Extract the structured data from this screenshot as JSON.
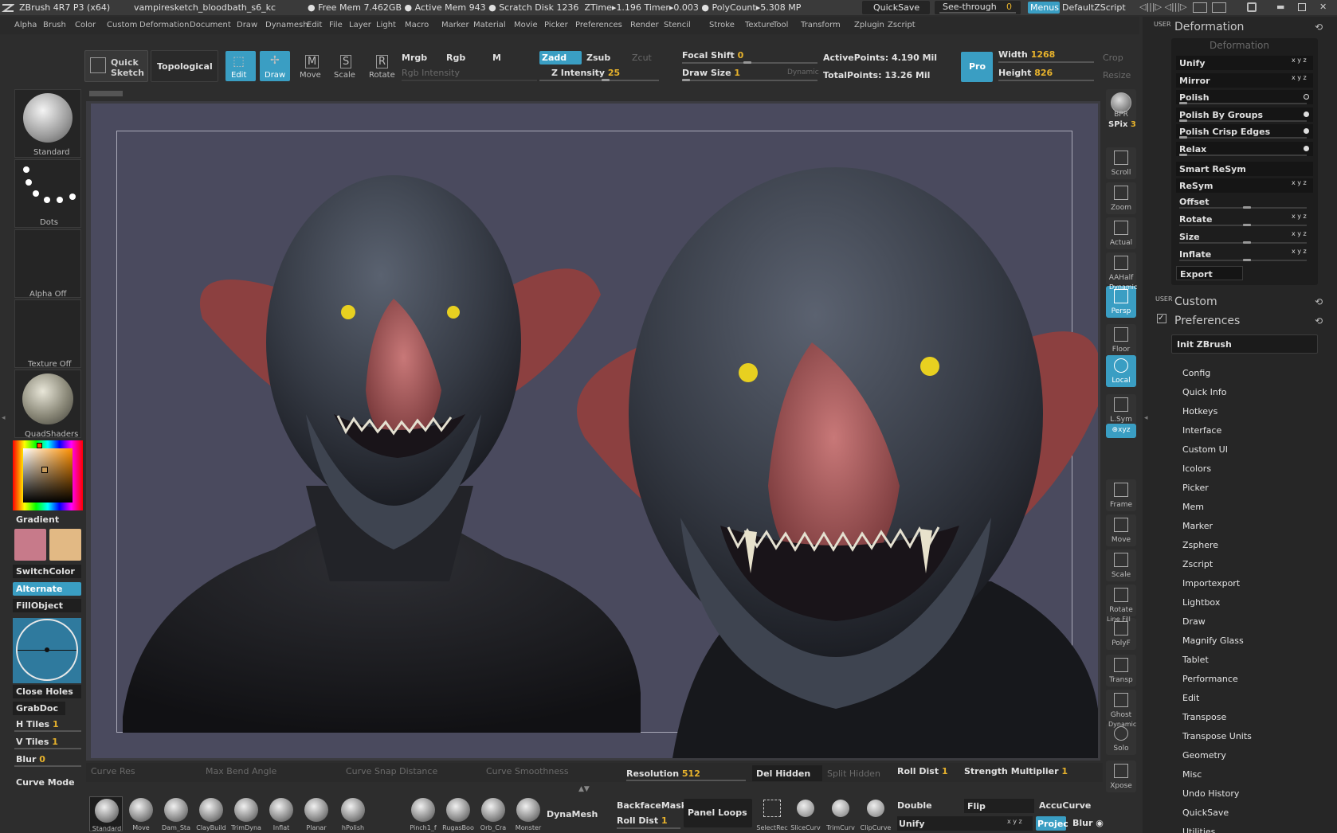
{
  "titlebar": {
    "app": "ZBrush 4R7 P3 (x64)",
    "file": "vampiresketch_bloodbath_s6_kc",
    "free_mem_label": "Free Mem",
    "free_mem": "7.462GB",
    "active_mem_label": "Active Mem",
    "active_mem": "943",
    "scratch_label": "Scratch Disk",
    "scratch": "1236",
    "ztime_label": "ZTime",
    "ztime": "1.196",
    "timer_label": "Timer",
    "timer": "0.003",
    "polycount_label": "PolyCount",
    "polycount": "5.308",
    "polycount_unit": "MP",
    "quicksave": "QuickSave",
    "seethrough_label": "See-through",
    "seethrough": "0",
    "menus": "Menus",
    "script": "DefaultZScript"
  },
  "menubar": [
    "Alpha",
    "Brush",
    "Color",
    "Custom",
    "Deformation",
    "Document",
    "Draw",
    "Dynamesh",
    "Edit",
    "File",
    "Layer",
    "Light",
    "Macro",
    "Marker",
    "Material",
    "Movie",
    "Picker",
    "Preferences",
    "Render",
    "Stencil",
    "Stroke",
    "Texture",
    "Tool",
    "Transform",
    "Zplugin",
    "Zscript"
  ],
  "toolbar": {
    "quick_sketch_1": "Quick",
    "quick_sketch_2": "Sketch",
    "topological": "Topological",
    "edit": "Edit",
    "draw": "Draw",
    "move": "Move",
    "scale": "Scale",
    "rotate": "Rotate",
    "mrgb": "Mrgb",
    "rgb": "Rgb",
    "m": "M",
    "rgb_intensity": "Rgb Intensity",
    "zadd": "Zadd",
    "zsub": "Zsub",
    "zcut": "Zcut",
    "z_intensity_label": "Z Intensity",
    "z_intensity": "25",
    "focal_shift_label": "Focal Shift",
    "focal_shift": "0",
    "draw_size_label": "Draw Size",
    "draw_size": "1",
    "dynamic": "Dynamic",
    "active_points_label": "ActivePoints:",
    "active_points": "4.190 Mil",
    "total_points_label": "TotalPoints:",
    "total_points": "13.26 Mil",
    "pro": "Pro",
    "width_label": "Width",
    "width": "1268",
    "height_label": "Height",
    "height": "826",
    "crop": "Crop",
    "resize": "Resize"
  },
  "leftpanel": {
    "brush": "Standard",
    "stroke": "Dots",
    "alpha": "Alpha  Off",
    "texture": "Texture  Off",
    "material": "QuadShaders",
    "gradient": "Gradient",
    "switchcolor": "SwitchColor",
    "alternate": "Alternate",
    "fillobject": "FillObject",
    "close_holes": "Close Holes",
    "grabdoc": "GrabDoc",
    "htiles_label": "H Tiles",
    "htiles": "1",
    "vtiles_label": "V Tiles",
    "vtiles": "1",
    "blur_label": "Blur",
    "blur": "0",
    "curve_mode": "Curve Mode",
    "main_color": "#c77a8a",
    "secondary_color": "#e2b984"
  },
  "rightshelf": {
    "bpr": "BPR",
    "spix_label": "SPix",
    "spix": "3",
    "scroll": "Scroll",
    "zoom": "Zoom",
    "actual": "Actual",
    "aahalf": "AAHalf",
    "dynamic": "Dynamic",
    "persp": "Persp",
    "floor": "Floor",
    "local": "Local",
    "lsym": "L.Sym",
    "xyz": "⊕xyz",
    "frame": "Frame",
    "move": "Move",
    "scale": "Scale",
    "rotate": "Rotate",
    "linefill": "Line Fill",
    "polyf": "PolyF",
    "transp": "Transp",
    "ghost": "Ghost",
    "dynamic2": "Dynamic",
    "solo": "Solo",
    "xpose": "Xpose"
  },
  "trays": {
    "user1": "USER",
    "deformation_title": "Deformation",
    "deformation_sub": "Deformation",
    "deform_items": [
      "Unify",
      "Mirror",
      "Polish",
      "Polish By Groups",
      "Polish Crisp Edges",
      "Relax",
      "Smart ReSym",
      "ReSym",
      "Offset",
      "Rotate",
      "Size",
      "Inflate",
      "Export"
    ],
    "xyz": "x y z",
    "user2": "USER",
    "custom": "Custom",
    "preferences": "Preferences",
    "init_zbrush": "Init ZBrush",
    "pref_items": [
      "Config",
      "Quick Info",
      "Hotkeys",
      "Interface",
      "Custom UI",
      "Icolors",
      "Picker",
      "Mem",
      "Marker",
      "Zsphere",
      "Zscript",
      "Importexport",
      "Lightbox",
      "Draw",
      "Magnify Glass",
      "Tablet",
      "Performance",
      "Edit",
      "Transpose",
      "Transpose Units",
      "Geometry",
      "Misc",
      "Undo History",
      "QuickSave",
      "Utilities"
    ]
  },
  "bottom_sliders": {
    "curve_res": "Curve Res",
    "max_bend": "Max Bend Angle",
    "curve_snap": "Curve Snap Distance",
    "curve_smooth": "Curve Smoothness",
    "resolution_label": "Resolution",
    "resolution": "512",
    "del_hidden": "Del Hidden",
    "split_hidden": "Split Hidden",
    "roll_dist_label": "Roll Dist",
    "roll_dist": "1",
    "strength_label": "Strength Multiplier",
    "strength": "1"
  },
  "bottom_shelf": {
    "brushes": [
      "Standard",
      "Move",
      "Dam_Sta",
      "ClayBuild",
      "TrimDyna",
      "Inflat",
      "Planar",
      "hPolish",
      "Pinch1_f",
      "RugasBoo",
      "Orb_Cra",
      "Monster"
    ],
    "dynamesh": "DynaMesh",
    "backfacemask": "BackfaceMask",
    "roll_dist_label": "Roll Dist",
    "roll_dist": "1",
    "panel_loops": "Panel Loops",
    "tools": [
      "SelectRec",
      "SliceCurv",
      "TrimCurv",
      "ClipCurve"
    ],
    "double": "Double",
    "flip": "Flip",
    "accucurve": "AccuCurve",
    "unify": "Unify",
    "xyz": "x y z",
    "projec": "Projec",
    "blur": "Blur"
  }
}
